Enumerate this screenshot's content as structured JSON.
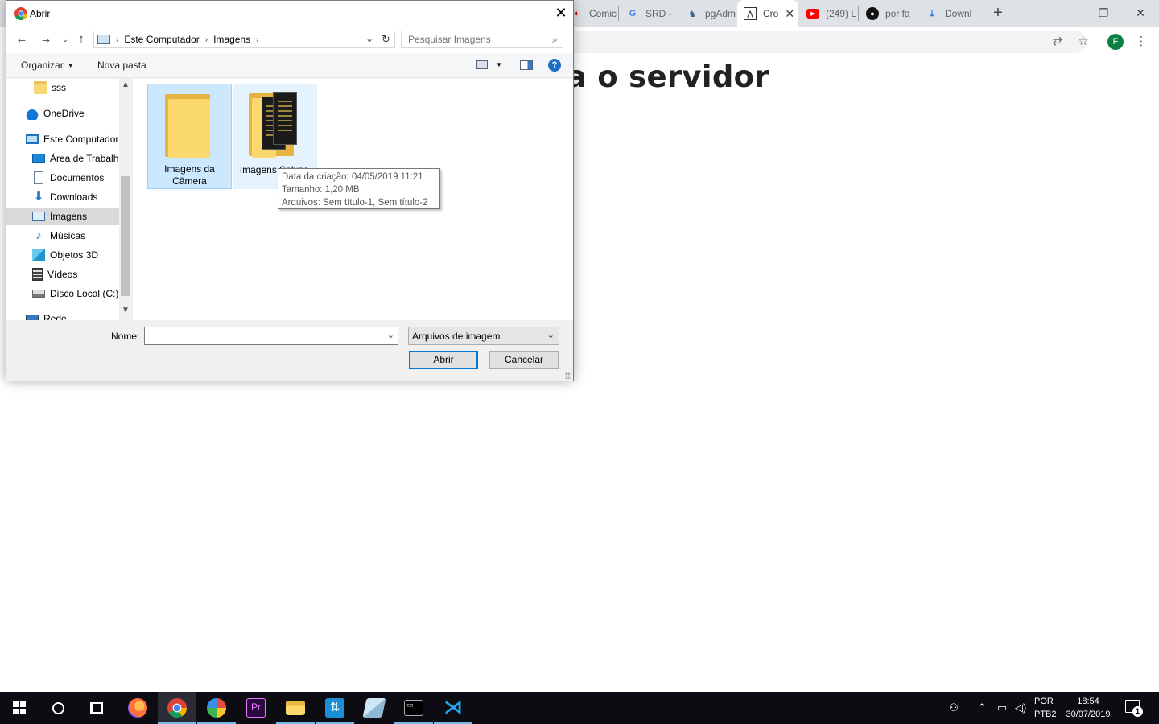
{
  "browser": {
    "tabs": [
      {
        "title": "Comic",
        "favicon": "comic-icon"
      },
      {
        "title": "SRD -",
        "favicon": "google-icon"
      },
      {
        "title": "pgAdm",
        "favicon": "pgadmin-icon"
      },
      {
        "title": "Cro",
        "favicon": "croodle-icon",
        "active": true
      },
      {
        "title": "(249) L",
        "favicon": "youtube-icon"
      },
      {
        "title": "por fa",
        "favicon": "github-icon"
      },
      {
        "title": "Downl",
        "favicon": "download-icon"
      }
    ],
    "avatar_letter": "F",
    "page_heading": "ara o servidor"
  },
  "dialog": {
    "title": "Abrir",
    "breadcrumb": [
      "Este Computador",
      "Imagens"
    ],
    "search_placeholder": "Pesquisar Imagens",
    "commands": {
      "organize": "Organizar",
      "new_folder": "Nova pasta",
      "help": "?"
    },
    "nav_items": [
      {
        "label": "sss",
        "icon": "folder-icon"
      },
      {
        "label": "OneDrive",
        "icon": "onedrive-icon"
      },
      {
        "label": "Este Computador",
        "icon": "computer-icon"
      },
      {
        "label": "Área de Trabalho",
        "icon": "desktop-icon"
      },
      {
        "label": "Documentos",
        "icon": "documents-icon"
      },
      {
        "label": "Downloads",
        "icon": "downloads-icon"
      },
      {
        "label": "Imagens",
        "icon": "pictures-icon",
        "selected": true
      },
      {
        "label": "Músicas",
        "icon": "music-icon"
      },
      {
        "label": "Objetos 3D",
        "icon": "objects-3d-icon"
      },
      {
        "label": "Vídeos",
        "icon": "videos-icon"
      },
      {
        "label": "Disco Local (C:)",
        "icon": "local-disk-icon"
      },
      {
        "label": "Rede",
        "icon": "network-icon"
      }
    ],
    "files": [
      {
        "label": "Imagens da Câmera",
        "selected": true
      },
      {
        "label": "Imagens Salvas",
        "selected": false
      }
    ],
    "tooltip": [
      "Data da criação: 04/05/2019 11:21",
      "Tamanho: 1,20 MB",
      "Arquivos: Sem título-1, Sem título-2"
    ],
    "name_label": "Nome:",
    "name_value": "",
    "file_type": "Arquivos de imagem",
    "open_button": "Abrir",
    "cancel_button": "Cancelar"
  },
  "taskbar": {
    "language": "POR",
    "keyboard": "PTB2",
    "time": "18:54",
    "date": "30/07/2019",
    "notification_count": "1"
  },
  "colors": {
    "selection": "#cce8ff",
    "accent": "#0078d7",
    "taskbar": "#0c0c12"
  }
}
